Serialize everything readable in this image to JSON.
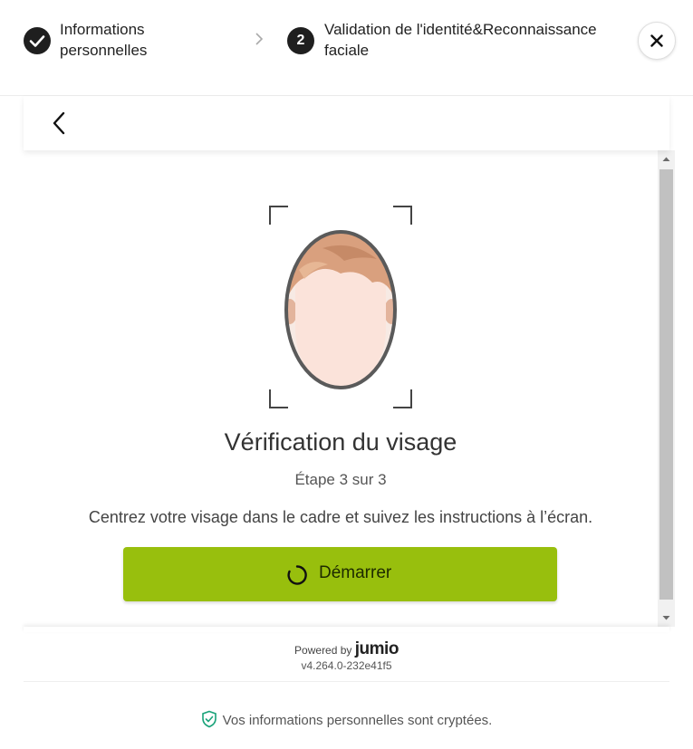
{
  "header": {
    "step1": {
      "label_line1": "Informations",
      "label_line2": "personnelles",
      "status": "completed"
    },
    "step2": {
      "number": "2",
      "label_line1": "Validation de l'identité&Reconnaissance",
      "label_line2": "faciale",
      "status": "active"
    },
    "close_icon": "close-icon"
  },
  "toolbar": {
    "back_icon": "chevron-left-icon"
  },
  "main": {
    "title": "Vérification du visage",
    "step_of": "Étape 3 sur 3",
    "instructions": "Centrez votre visage dans le cadre et suivez les instructions à l’écran.",
    "start_button": {
      "label": "Démarrer",
      "icon": "spinner-icon"
    }
  },
  "footer": {
    "powered_prefix": "Powered by",
    "brand": "jumio",
    "version": "v4.264.0-232e41f5",
    "secure_text": "Vos informations personnelles sont cryptées.",
    "secure_icon": "shield-check-icon"
  },
  "colors": {
    "accent": "#98bf0d",
    "dark": "#1f1f1f",
    "secure_icon": "#1aa37a"
  }
}
